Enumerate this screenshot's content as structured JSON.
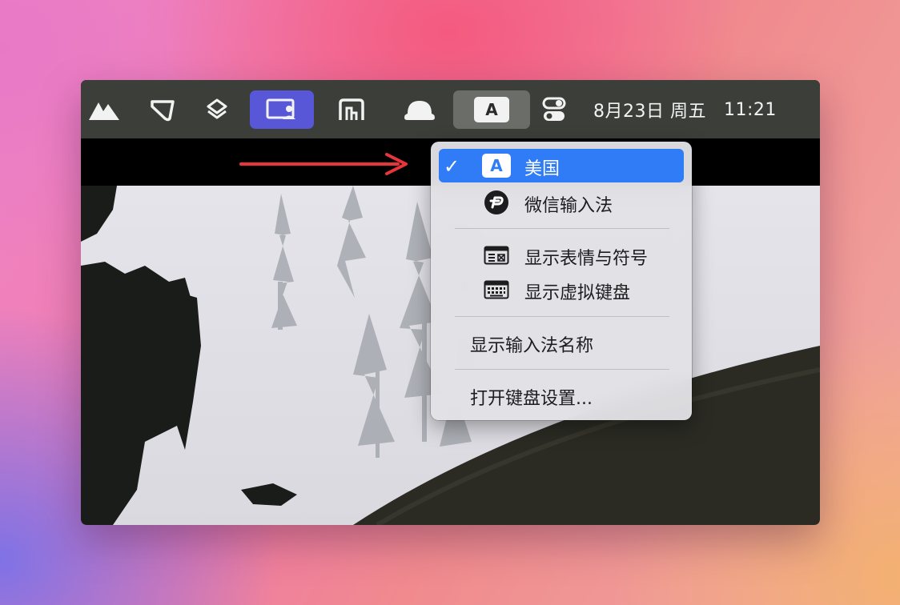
{
  "menubar": {
    "icons": [
      "mountains-icon",
      "notch-app-icon",
      "layers-icon",
      "screen-share-icon",
      "stage-manager-icon",
      "cloud-dome-icon",
      "input-source-icon",
      "control-center-icon"
    ],
    "input_source_letter": "A",
    "date": "8月23日 周五",
    "time": "11:21",
    "highlight_colors": {
      "active_app": "#5857d8",
      "open_menu": "#6b6d69"
    }
  },
  "input_menu": {
    "items": [
      {
        "label": "美国",
        "icon_letter": "A",
        "checked": true,
        "selected": true
      },
      {
        "label": "微信输入法",
        "icon": "wechat-ime-icon",
        "checked": false
      }
    ],
    "actions_group1": [
      {
        "label": "显示表情与符号",
        "icon": "emoji-symbols-icon"
      },
      {
        "label": "显示虚拟键盘",
        "icon": "virtual-keyboard-icon"
      }
    ],
    "show_name_label": "显示输入法名称",
    "open_settings_label": "打开键盘设置...",
    "check_mark": "✓",
    "selection_color": "#2f7cf6"
  },
  "annotation": {
    "arrow_color": "#e8343b"
  }
}
